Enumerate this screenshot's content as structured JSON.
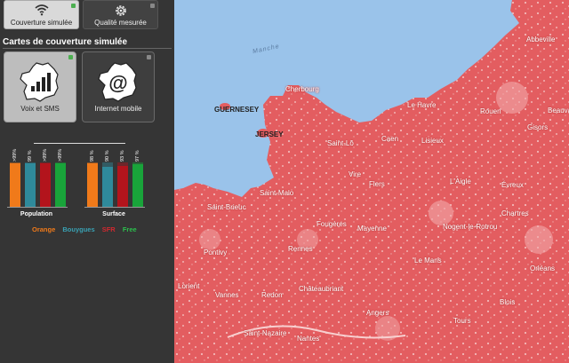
{
  "top_buttons": {
    "sim_label": "Couverture simulée",
    "mes_label": "Qualité mesurée"
  },
  "section_title": "Cartes de couverture simulée",
  "mode_buttons": {
    "voix_label": "Voix et SMS",
    "internet_label": "Internet mobile"
  },
  "chart_data": [
    {
      "type": "bar",
      "title": "Population",
      "categories": [
        "Orange",
        "Bouygues",
        "SFR",
        "Free"
      ],
      "values": [
        99,
        99,
        99,
        99
      ],
      "labels": [
        ">99%",
        "99 %",
        ">99%",
        ">99%"
      ],
      "colors": [
        "#f07a1a",
        "#2f8a9b",
        "#b3141c",
        "#19a43a"
      ],
      "ylim": [
        0,
        100
      ]
    },
    {
      "type": "bar",
      "title": "Surface",
      "categories": [
        "Orange",
        "Bouygues",
        "SFR",
        "Free"
      ],
      "values": [
        98,
        90,
        93,
        97
      ],
      "labels": [
        "98 %",
        "90 %",
        "93 %",
        "97 %"
      ],
      "colors": [
        "#f07a1a",
        "#2f8a9b",
        "#b3141c",
        "#19a43a"
      ],
      "ylim": [
        0,
        100
      ]
    }
  ],
  "legend": {
    "orange": "Orange",
    "bouygues": "Bouygues",
    "sfr": "SFR",
    "free": "Free"
  },
  "map": {
    "sea_label": "Manche",
    "islands": {
      "guernsey": "GUERNESEY",
      "jersey": "JERSEY"
    },
    "places": {
      "cherbourg": "Cherbourg",
      "le_havre": "Le Havre",
      "rouen": "Rouen",
      "abbeville": "Abbeville",
      "lisieux": "Lisieux",
      "caen": "Caen",
      "saint_lo": "Saint-Lô",
      "vire": "Vire",
      "flers": "Flers",
      "laigle": "L'Aigle",
      "evreux": "Évreux",
      "beauvais": "Beauvais",
      "gisors": "Gisors",
      "saint_malo": "Saint-Malo",
      "saint_brieuc": "Saint-Brieuc",
      "fougeres": "Fougères",
      "mayenne": "Mayenne",
      "nogent": "Nogent-le-Rotrou",
      "chartres": "Chartres",
      "rennes": "Rennes",
      "le_mans": "Le Mans",
      "orleans": "Orléans",
      "pontivy": "Pontivy",
      "lorient": "Lorient",
      "vannes": "Vannes",
      "redon": "Redon",
      "chateaubriant": "Châteaubriant",
      "angers": "Angers",
      "blois": "Blois",
      "tours": "Tours",
      "saint_nazaire": "Saint-Nazaire",
      "nantes": "Nantes"
    }
  }
}
